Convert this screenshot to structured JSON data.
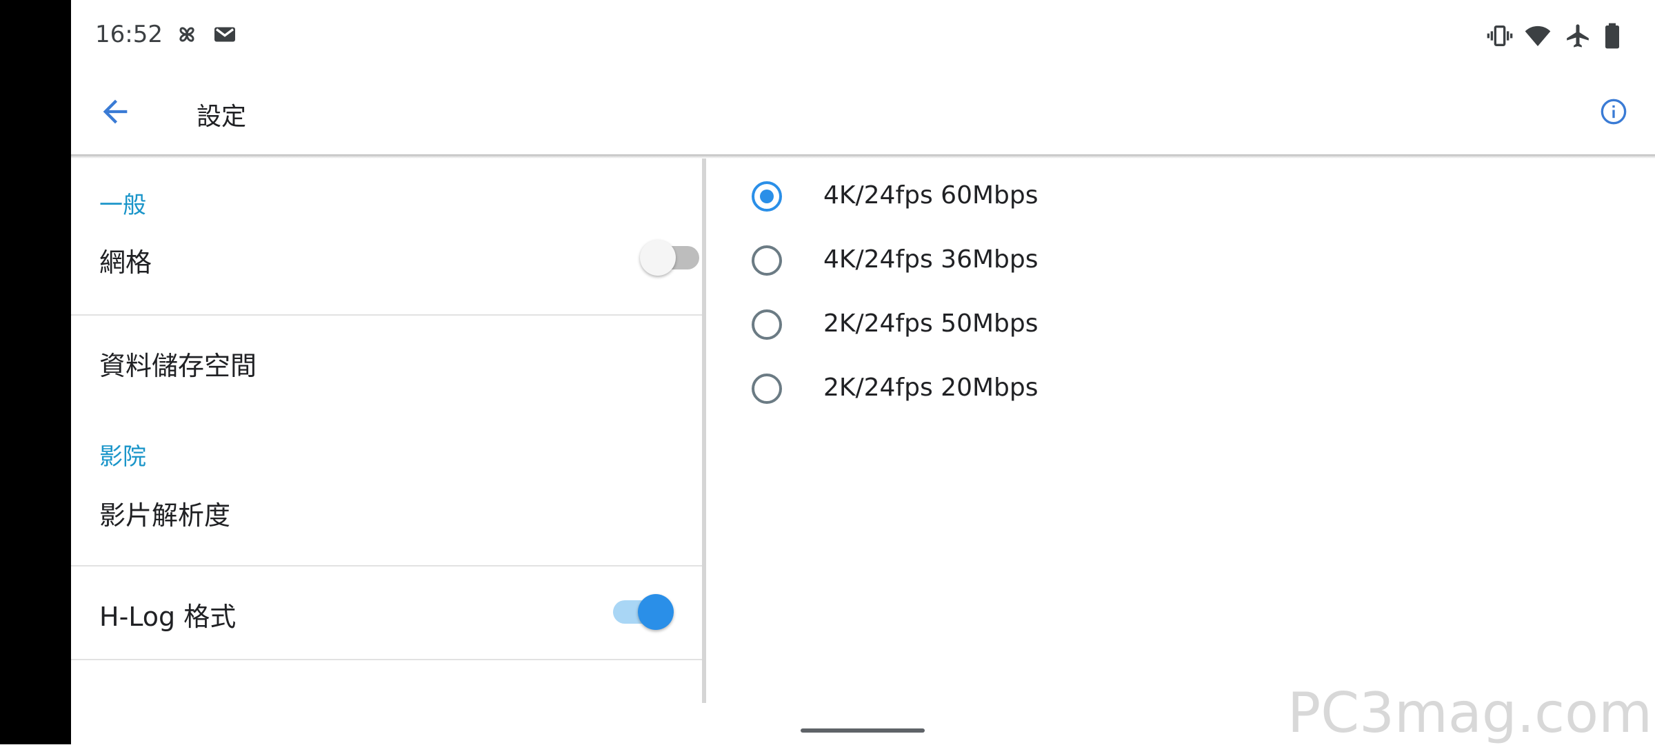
{
  "status_bar": {
    "time": "16:52",
    "left_icons": [
      "pinwheel-icon",
      "gmail-icon"
    ],
    "right_icons": [
      "vibrate-icon",
      "wifi-icon",
      "airplane-icon",
      "battery-icon"
    ]
  },
  "app_bar": {
    "title": "設定",
    "back_icon": "arrow-back-icon",
    "info_icon": "info-icon"
  },
  "settings": {
    "general_header": "一般",
    "grid_label": "網格",
    "grid_enabled": false,
    "storage_label": "資料儲存空間",
    "cinema_header": "影院",
    "resolution_label": "影片解析度",
    "hlog_label": "H-Log 格式",
    "hlog_enabled": true
  },
  "resolution_options": [
    {
      "label": "4K/24fps 60Mbps",
      "selected": true
    },
    {
      "label": "4K/24fps 36Mbps",
      "selected": false
    },
    {
      "label": "2K/24fps 50Mbps",
      "selected": false
    },
    {
      "label": "2K/24fps 20Mbps",
      "selected": false
    }
  ],
  "watermark": "PC3mag.com",
  "colors": {
    "accent": "#2a8fe8",
    "section_header": "#1a95c9",
    "radio_unselected": "#6b7b84"
  }
}
